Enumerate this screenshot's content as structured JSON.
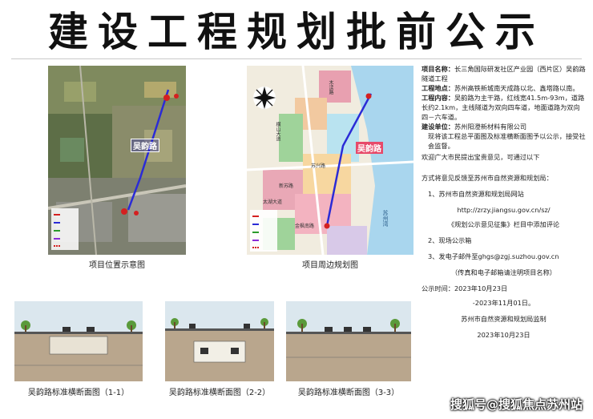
{
  "title": "建设工程规划批前公示",
  "captions": {
    "location_map": "项目位置示意图",
    "surrounding_map": "项目周边规划图",
    "section1": "吴韵路标准横断面图（1-1）",
    "section2": "吴韵路标准横断面图（2-2）",
    "section3": "吴韵路标准横断面图（3-3）"
  },
  "map_labels": {
    "road_name": "吴韵路",
    "road_label_right": "吴韵路",
    "places": [
      "木渎路",
      "横山大道",
      "苏兴路",
      "新苏路",
      "太湖大道",
      "金枫南路",
      "苏州湾"
    ]
  },
  "info": {
    "project_name_label": "项目名称：",
    "project_name": "长三角国际研发社区产业园（西片区）吴韵路隧道工程",
    "location_label": "工程地点：",
    "location": "苏州高铁新城南天成路以北、鑫塔路以南。",
    "content_label": "工程内容：",
    "content": "吴韵路为主干路，红线宽41.5m-93m，道路长约2.1km，主线隧道为双向四车道，地面道路为双向四－六车道。",
    "builder_label": "建设单位：",
    "builder": "苏州阳澄新材料有限公司",
    "notice": "现将该工程总平面图及标准横断面图予以公示，接受社会监督。",
    "invite": "欢迎广大市民提出宝贵意见，可通过以下",
    "methods_intro": "方式将意见反馈至苏州市自然资源和规划局：",
    "item1": "1、苏州市自然资源和规划局网站",
    "item1_url": "http://zrzy.jiangsu.gov.cn/sz/",
    "item1_note": "《规划公示意见征集》栏目中添加评论",
    "item2": "2、现场公示箱",
    "item3": "3、发电子邮件至ghgs@zgj.suzhou.gov.cn",
    "fax_note": "（传真和电子邮箱请注明项目名称）",
    "time_label": "公示时间：2023年10月23日",
    "time_end": "-2023年11月01日。",
    "supervisor": "苏州市自然资源和规划局监制",
    "date": "2023年10月23日"
  },
  "watermark": "搜狐号@搜狐焦点苏州站",
  "colors": {
    "route": "#2b2bd6",
    "red_marker": "#d42020",
    "sky": "#dbe7ee",
    "ground": "#b9a68d",
    "water": "#a9d6ee"
  }
}
